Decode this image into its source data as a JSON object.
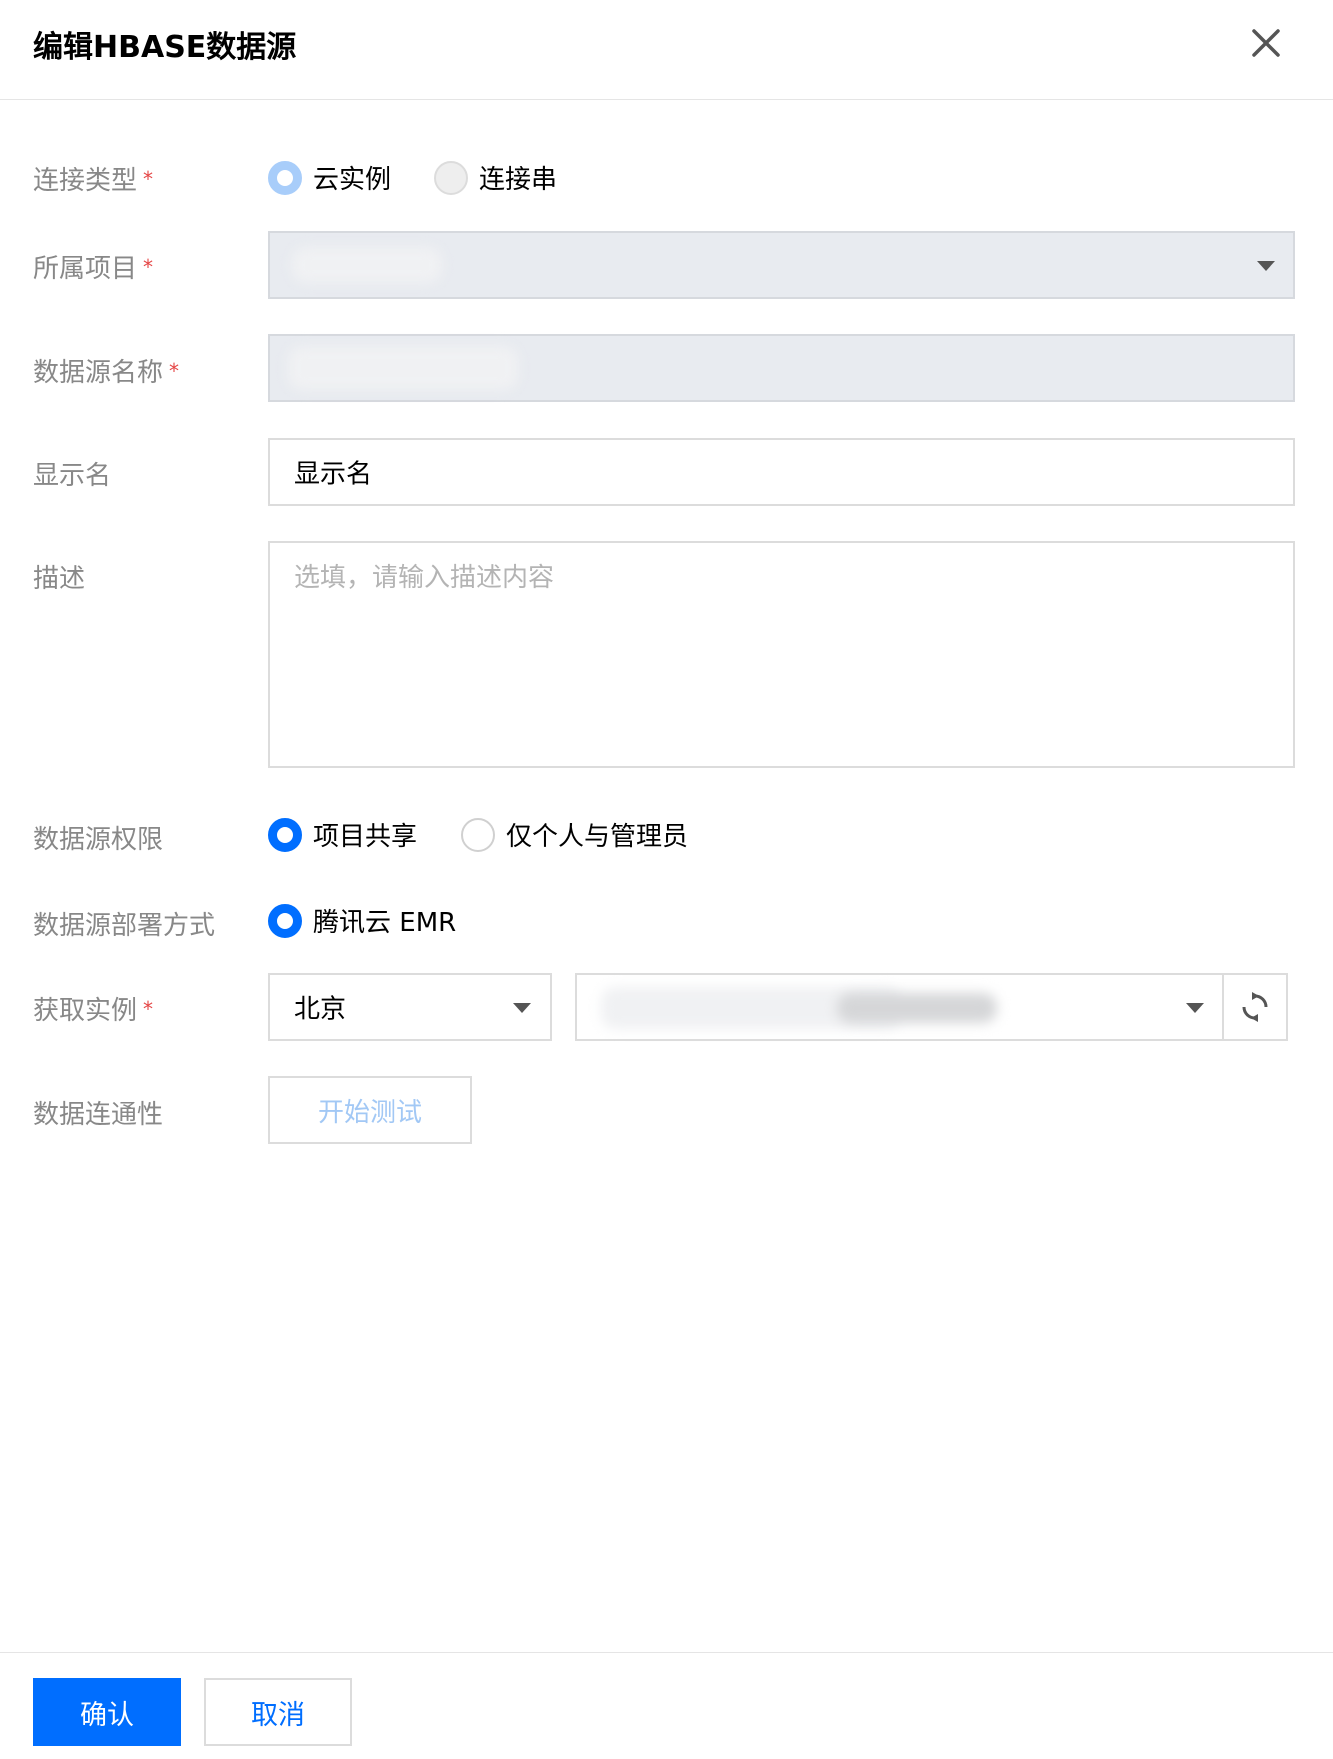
{
  "dialog": {
    "title": "编辑HBASE数据源"
  },
  "form": {
    "connection_type": {
      "label": "连接类型",
      "required_mark": "*",
      "options": [
        {
          "label": "云实例",
          "state": "checked-disabled"
        },
        {
          "label": "连接串",
          "state": "disabled"
        }
      ]
    },
    "project": {
      "label": "所属项目",
      "required_mark": "*",
      "value_obscured": true,
      "disabled": true
    },
    "datasource_name": {
      "label": "数据源名称",
      "required_mark": "*",
      "value_obscured": true,
      "disabled": true
    },
    "display_name": {
      "label": "显示名",
      "value": "显示名"
    },
    "description": {
      "label": "描述",
      "placeholder": "选填，请输入描述内容",
      "value": ""
    },
    "permission": {
      "label": "数据源权限",
      "options": [
        {
          "label": "项目共享",
          "state": "checked"
        },
        {
          "label": "仅个人与管理员",
          "state": "unchecked"
        }
      ]
    },
    "deployment": {
      "label": "数据源部署方式",
      "options": [
        {
          "label": "腾讯云 EMR",
          "state": "checked"
        }
      ]
    },
    "instance": {
      "label": "获取实例",
      "required_mark": "*",
      "region": "北京",
      "instance_value_obscured": true,
      "refresh_icon": "refresh-icon"
    },
    "connectivity": {
      "label": "数据连通性",
      "test_button": "开始测试"
    }
  },
  "footer": {
    "confirm": "确认",
    "cancel": "取消"
  },
  "colors": {
    "primary": "#006eff",
    "required": "#e54545",
    "label": "#888888",
    "border": "#dcdcdc",
    "disabled_bg": "#e8ebf0"
  }
}
